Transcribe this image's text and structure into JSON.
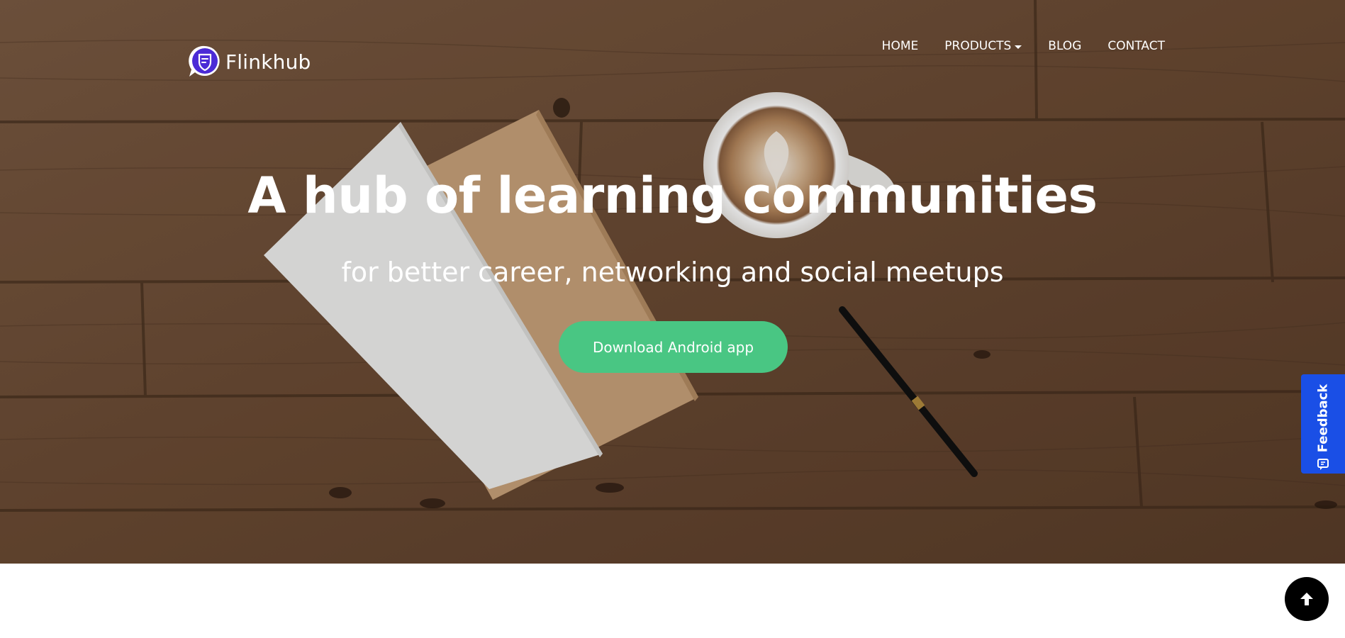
{
  "brand": {
    "name": "Flinkhub",
    "logo_icon": "chat-bubble-shield-icon",
    "logo_color": "#4b2bd6"
  },
  "nav": {
    "items": [
      {
        "label": "HOME"
      },
      {
        "label": "PRODUCTS",
        "has_dropdown": true
      },
      {
        "label": "BLOG"
      },
      {
        "label": "CONTACT"
      }
    ]
  },
  "hero": {
    "title": "A hub of learning communities",
    "subtitle": "for better career, networking and social meetups",
    "cta_label": "Download Android app",
    "cta_color": "#49c683",
    "background": "wood-desk-with-notebooks-coffee-pen"
  },
  "feedback": {
    "label": "Feedback",
    "icon": "feedback-icon",
    "color": "#1a4fe6"
  },
  "scroll_top": {
    "icon": "arrow-up-icon"
  }
}
